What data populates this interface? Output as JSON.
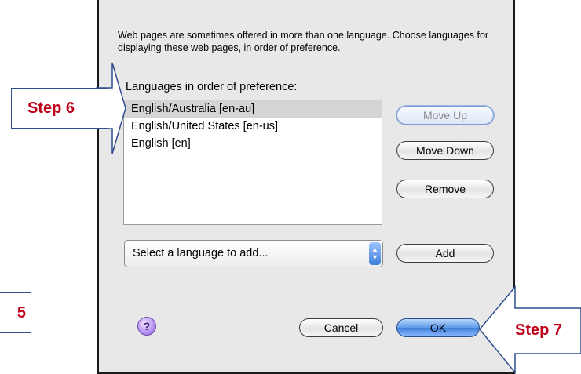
{
  "dialog": {
    "intro_text": "Web pages are sometimes offered in more than one language. Choose languages for displaying these web pages, in order of preference.",
    "list_heading": "Languages in order of preference:",
    "languages": [
      {
        "label": "English/Australia  [en-au]",
        "selected": true
      },
      {
        "label": "English/United States  [en-us]",
        "selected": false
      },
      {
        "label": "English  [en]",
        "selected": false
      }
    ],
    "buttons": {
      "move_up": "Move Up",
      "move_down": "Move Down",
      "remove": "Remove",
      "add": "Add",
      "cancel": "Cancel",
      "ok": "OK"
    },
    "language_select": {
      "selected": "Select a language to add..."
    },
    "help_label": "?"
  },
  "annotations": {
    "step6": "Step 6",
    "step7": "Step 7",
    "partial": "5"
  },
  "colors": {
    "callout_text": "#c0001a",
    "callout_border": "#2f4f8f",
    "dialog_bg": "#e8e8e8",
    "default_button": "#3f80dc",
    "selected_row": "#d4d4d4"
  }
}
